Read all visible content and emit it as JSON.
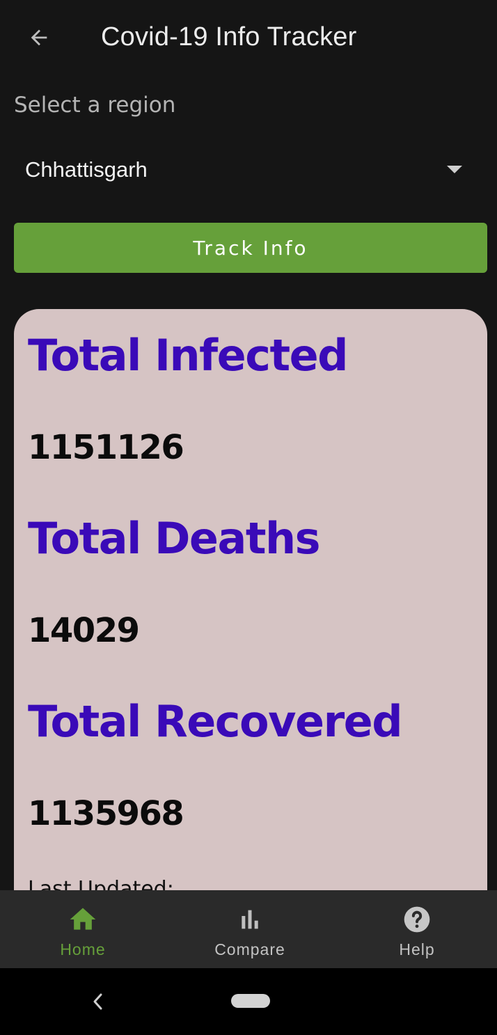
{
  "app_bar": {
    "title": "Covid-19 Info Tracker",
    "back_icon": "arrow-back-icon"
  },
  "region": {
    "label": "Select a region",
    "selected": "Chhattisgarh",
    "dropdown_icon": "dropdown-arrow-icon"
  },
  "track_button": {
    "label": "Track Info",
    "color": "#66a03a"
  },
  "card": {
    "background": "#d6c4c4",
    "heading_color": "#3a0ab8",
    "infected_label": "Total Infected",
    "infected_value": "1151126",
    "deaths_label": "Total Deaths",
    "deaths_value": "14029",
    "recovered_label": "Total Recovered",
    "recovered_value": "1135968",
    "last_updated_label": "Last Updated:"
  },
  "bottom_nav": {
    "items": [
      {
        "label": "Home",
        "icon": "home-icon",
        "active": true
      },
      {
        "label": "Compare",
        "icon": "bar-chart-icon",
        "active": false
      },
      {
        "label": "Help",
        "icon": "help-icon",
        "active": false
      }
    ],
    "active_color": "#66a03a"
  },
  "system_nav": {
    "back_icon": "system-back-icon",
    "home_icon": "system-home-pill"
  }
}
